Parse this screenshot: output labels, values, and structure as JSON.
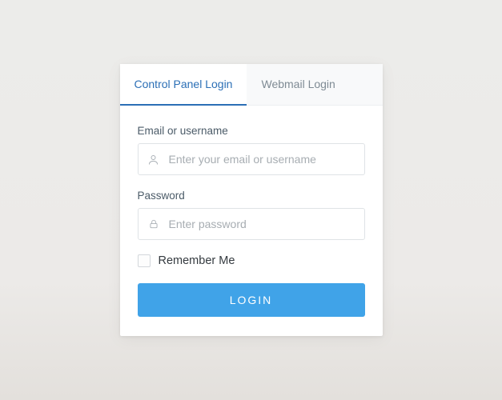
{
  "colors": {
    "accent": "#2b6fb6",
    "button": "#40a3e8",
    "tab_inactive_text": "#7f8b94",
    "label_text": "#4b5b68"
  },
  "tabs": [
    {
      "label": "Control Panel Login",
      "active": true
    },
    {
      "label": "Webmail Login",
      "active": false
    }
  ],
  "fields": {
    "username": {
      "label": "Email or username",
      "placeholder": "Enter your email or username",
      "value": "",
      "icon": "user-icon"
    },
    "password": {
      "label": "Password",
      "placeholder": "Enter password",
      "value": "",
      "icon": "lock-icon"
    }
  },
  "remember": {
    "checked": false,
    "label": "Remember Me"
  },
  "submit": {
    "label": "LOGIN"
  }
}
